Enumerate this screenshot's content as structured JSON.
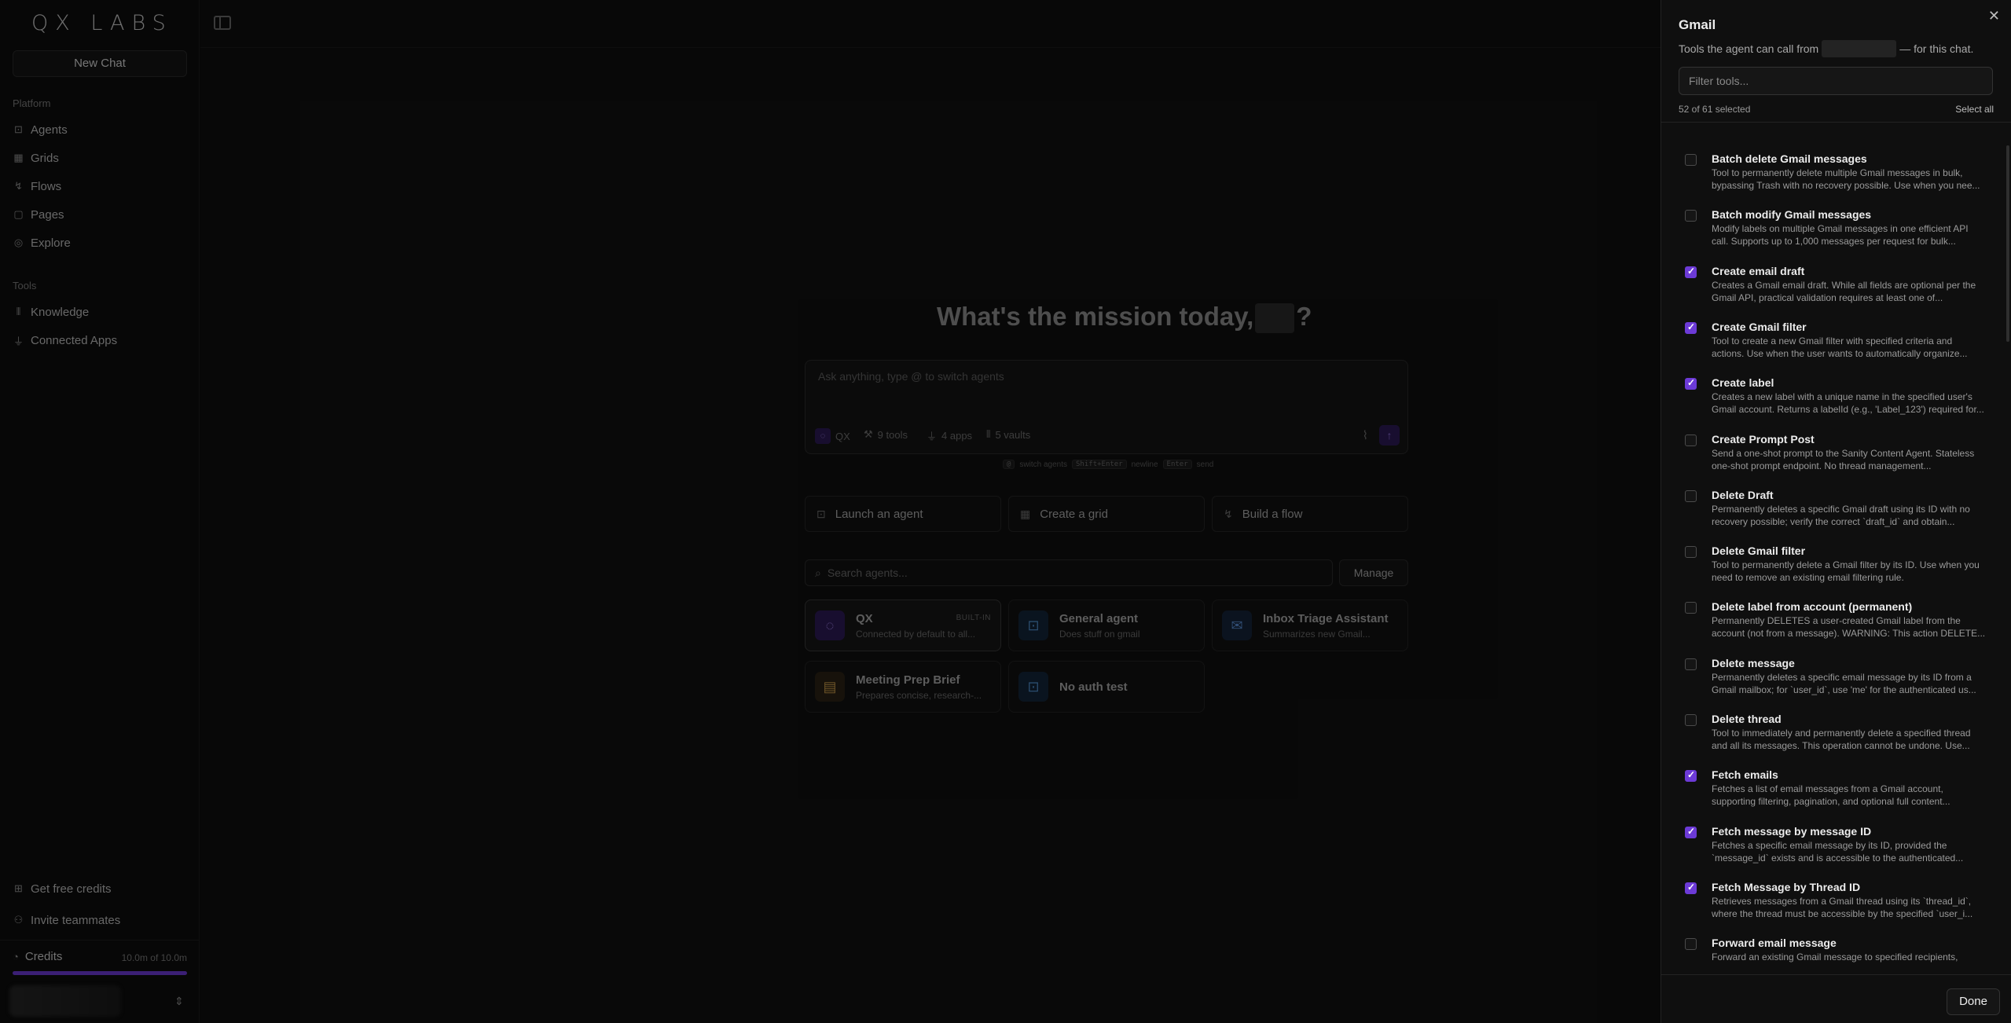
{
  "sidebar": {
    "logo": "QX LABS",
    "new_chat": "New Chat",
    "platform_label": "Platform",
    "platform_items": [
      {
        "label": "Agents",
        "icon": "agents-icon"
      },
      {
        "label": "Grids",
        "icon": "grid-icon"
      },
      {
        "label": "Flows",
        "icon": "flow-icon"
      },
      {
        "label": "Pages",
        "icon": "page-icon"
      },
      {
        "label": "Explore",
        "icon": "compass-icon"
      }
    ],
    "tools_label": "Tools",
    "tools_items": [
      {
        "label": "Knowledge",
        "icon": "library-icon"
      },
      {
        "label": "Connected Apps",
        "icon": "plug-icon"
      }
    ],
    "bottom_items": [
      {
        "label": "Get free credits",
        "icon": "gift-icon"
      },
      {
        "label": "Invite teammates",
        "icon": "user-plus-icon"
      }
    ],
    "credits_label": "Credits",
    "credits_value": "10.0m of 10.0m",
    "credits_fraction": 1.0
  },
  "main": {
    "hero_prefix": "What's the mission today,",
    "hero_suffix": "?",
    "composer_placeholder": "Ask anything, type @ to switch agents",
    "chips": {
      "agent": "QX",
      "tools": "9 tools",
      "apps": "4 apps",
      "vaults": "5 vaults"
    },
    "hints": {
      "switch_key": "@",
      "switch_label": "switch agents",
      "newline_key": "Shift+Enter",
      "newline_label": "newline",
      "send_key": "Enter",
      "send_label": "send"
    },
    "quick_actions": [
      "Launch an agent",
      "Create a grid",
      "Build a flow"
    ],
    "agent_search_placeholder": "Search agents...",
    "manage": "Manage",
    "agents": [
      {
        "title": "QX",
        "sub": "Connected by default to all...",
        "badge": "BUILT-IN"
      },
      {
        "title": "General agent",
        "sub": "Does stuff on gmail"
      },
      {
        "title": "Inbox Triage Assistant",
        "sub": "Summarizes new Gmail..."
      },
      {
        "title": "Meeting Prep Brief",
        "sub": "Prepares concise, research-..."
      },
      {
        "title": "No auth test"
      }
    ]
  },
  "panel": {
    "title": "Gmail",
    "subtitle_pre": "Tools the agent can call from",
    "subtitle_post": "— for this chat.",
    "filter_placeholder": "Filter tools...",
    "selected_count": "52 of 61 selected",
    "select_all": "Select all",
    "done": "Done",
    "tools": [
      {
        "name": "Batch delete Gmail messages",
        "desc": "Tool to permanently delete multiple Gmail messages in bulk, bypassing Trash with no recovery possible. Use when you nee...",
        "checked": false
      },
      {
        "name": "Batch modify Gmail messages",
        "desc": "Modify labels on multiple Gmail messages in one efficient API call. Supports up to 1,000 messages per request for bulk...",
        "checked": false
      },
      {
        "name": "Create email draft",
        "desc": "Creates a Gmail email draft. While all fields are optional per the Gmail API, practical validation requires at least one of...",
        "checked": true
      },
      {
        "name": "Create Gmail filter",
        "desc": "Tool to create a new Gmail filter with specified criteria and actions. Use when the user wants to automatically organize...",
        "checked": true
      },
      {
        "name": "Create label",
        "desc": "Creates a new label with a unique name in the specified user's Gmail account. Returns a labelId (e.g., 'Label_123') required for...",
        "checked": true
      },
      {
        "name": "Create Prompt Post",
        "desc": "Send a one-shot prompt to the Sanity Content Agent. Stateless one-shot prompt endpoint. No thread management...",
        "checked": false
      },
      {
        "name": "Delete Draft",
        "desc": "Permanently deletes a specific Gmail draft using its ID with no recovery possible; verify the correct `draft_id` and obtain...",
        "checked": false
      },
      {
        "name": "Delete Gmail filter",
        "desc": "Tool to permanently delete a Gmail filter by its ID. Use when you need to remove an existing email filtering rule.",
        "checked": false
      },
      {
        "name": "Delete label from account (permanent)",
        "desc": "Permanently DELETES a user-created Gmail label from the account (not from a message). WARNING: This action DELETE...",
        "checked": false
      },
      {
        "name": "Delete message",
        "desc": "Permanently deletes a specific email message by its ID from a Gmail mailbox; for `user_id`, use 'me' for the authenticated us...",
        "checked": false
      },
      {
        "name": "Delete thread",
        "desc": "Tool to immediately and permanently delete a specified thread and all its messages. This operation cannot be undone. Use...",
        "checked": false
      },
      {
        "name": "Fetch emails",
        "desc": "Fetches a list of email messages from a Gmail account, supporting filtering, pagination, and optional full content...",
        "checked": true
      },
      {
        "name": "Fetch message by message ID",
        "desc": "Fetches a specific email message by its ID, provided the `message_id` exists and is accessible to the authenticated...",
        "checked": true
      },
      {
        "name": "Fetch Message by Thread ID",
        "desc": "Retrieves messages from a Gmail thread using its `thread_id`, where the thread must be accessible by the specified `user_i...",
        "checked": true
      },
      {
        "name": "Forward email message",
        "desc": "Forward an existing Gmail message to specified recipients,",
        "checked": false
      }
    ]
  },
  "colors": {
    "accent": "#6c3ad6",
    "background": "#0b0b0b",
    "panel": "#0f0f0f"
  }
}
